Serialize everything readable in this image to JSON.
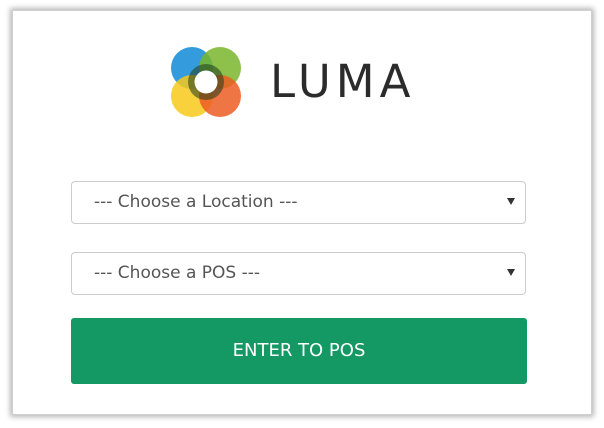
{
  "brand": {
    "name": "LUMA",
    "colors": {
      "blue": "#1e90d8",
      "green": "#79b62b",
      "yellow": "#f7c91a",
      "orange": "#ec5d23",
      "wordmark": "#2b2b2b"
    }
  },
  "form": {
    "location_select": {
      "selected": "--- Choose a Location ---"
    },
    "pos_select": {
      "selected": "--- Choose a POS ---"
    },
    "enter_button": {
      "label": "ENTER TO POS",
      "color": "#149965"
    }
  },
  "icons": {
    "dropdown": "caret-down-icon"
  }
}
